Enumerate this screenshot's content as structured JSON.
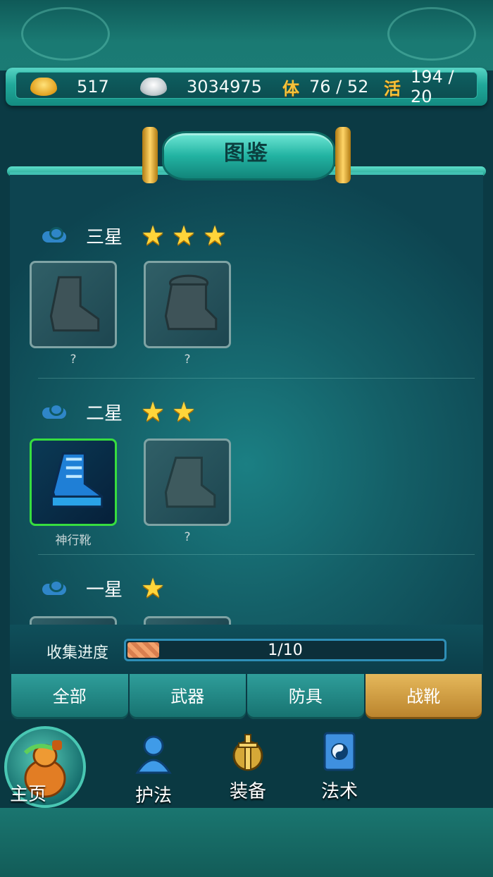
{
  "resources": {
    "gold": "517",
    "silver": "3034975",
    "stamina_glyph": "体",
    "stamina": "76 / 52",
    "activity_glyph": "活",
    "activity": "194 / 20"
  },
  "title": "图鉴",
  "sections": [
    {
      "label": "三星",
      "stars": 3,
      "items": [
        {
          "name": "?",
          "owned": false
        },
        {
          "name": "?",
          "owned": false
        }
      ]
    },
    {
      "label": "二星",
      "stars": 2,
      "items": [
        {
          "name": "神行靴",
          "owned": true
        },
        {
          "name": "?",
          "owned": false
        }
      ]
    },
    {
      "label": "一星",
      "stars": 1,
      "items": []
    }
  ],
  "progress": {
    "label": "收集进度",
    "text": "1/10",
    "value": 0.1
  },
  "tabs": [
    {
      "label": "全部",
      "active": false
    },
    {
      "label": "武器",
      "active": false
    },
    {
      "label": "防具",
      "active": false
    },
    {
      "label": "战靴",
      "active": true
    }
  ],
  "nav": {
    "home": "主页",
    "guardian": "护法",
    "equipment": "装备",
    "spells": "法术"
  },
  "colors": {
    "accent": "#22b3a2",
    "active_tab": "#d6a24b",
    "owned_border": "#37dd3f",
    "star": "#ffd53a"
  }
}
